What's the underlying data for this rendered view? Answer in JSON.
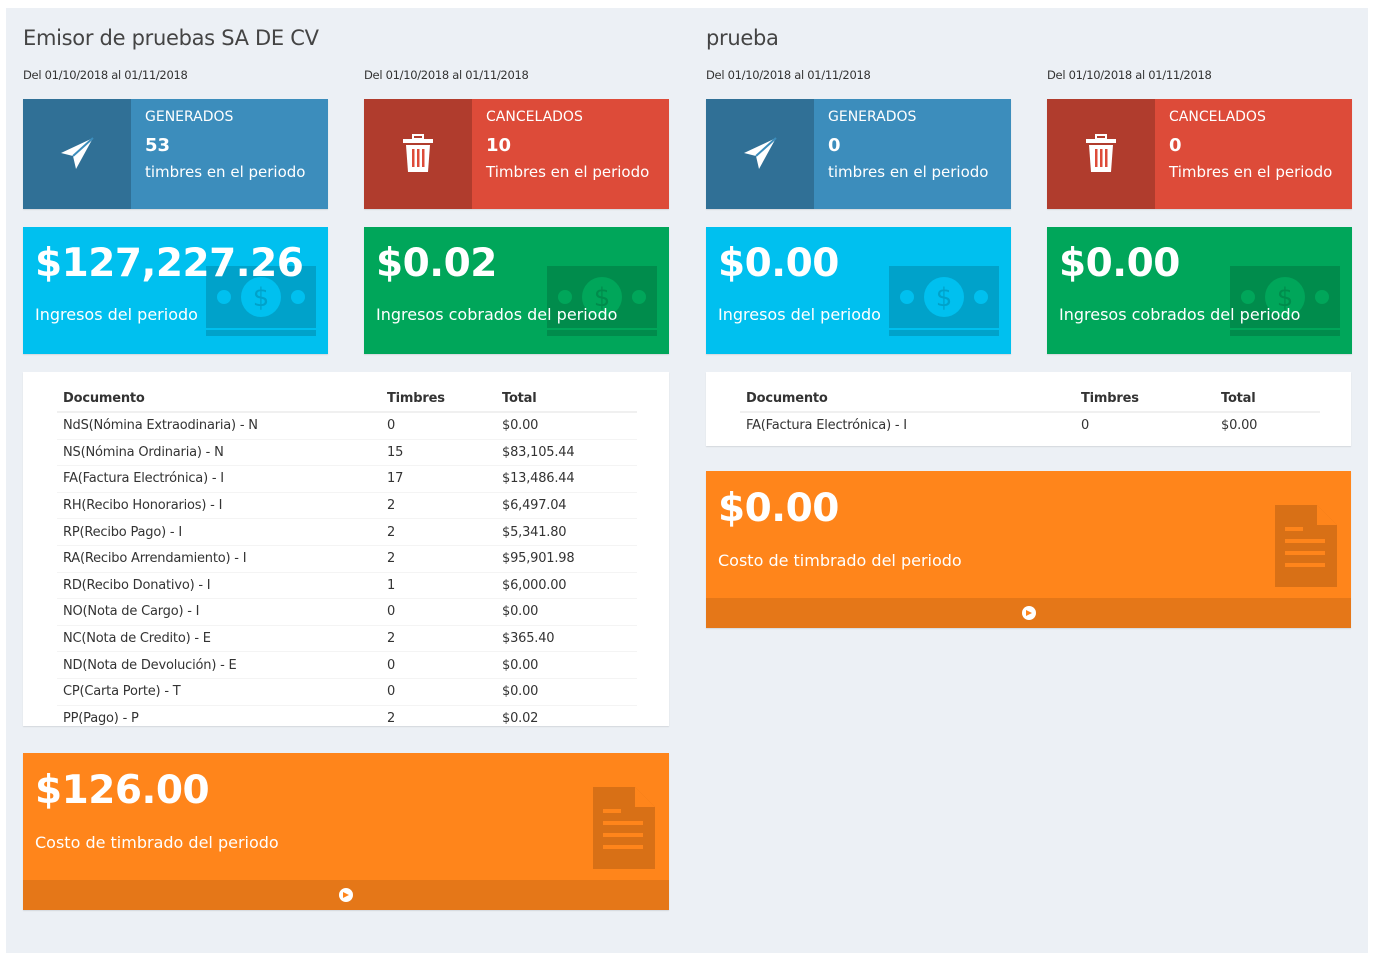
{
  "columns": [
    {
      "title": "Emisor de pruebas SA DE CV",
      "period_a": "Del 01/10/2018 al 01/11/2018",
      "period_b": "Del 01/10/2018 al 01/11/2018",
      "generados": {
        "label": "GENERADOS",
        "number": "53",
        "desc": "timbres en el periodo",
        "icon": "paper-plane-icon"
      },
      "cancelados": {
        "label": "CANCELADOS",
        "number": "10",
        "desc": "Timbres en el periodo",
        "icon": "trash-icon"
      },
      "ingresos": {
        "value": "$127,227.26",
        "desc": "Ingresos del periodo",
        "icon": "money-icon"
      },
      "cobrados": {
        "value": "$0.02",
        "desc": "Ingresos cobrados del periodo",
        "icon": "money-icon"
      },
      "table": {
        "headers": [
          "Documento",
          "Timbres",
          "Total"
        ],
        "rows": [
          [
            "NdS(Nómina Extraodinaria) - N",
            "0",
            "$0.00"
          ],
          [
            "NS(Nómina Ordinaria) - N",
            "15",
            "$83,105.44"
          ],
          [
            "FA(Factura Electrónica) - I",
            "17",
            "$13,486.44"
          ],
          [
            "RH(Recibo Honorarios) - I",
            "2",
            "$6,497.04"
          ],
          [
            "RP(Recibo Pago) - I",
            "2",
            "$5,341.80"
          ],
          [
            "RA(Recibo Arrendamiento) - I",
            "2",
            "$95,901.98"
          ],
          [
            "RD(Recibo Donativo) - I",
            "1",
            "$6,000.00"
          ],
          [
            "NO(Nota de Cargo) - I",
            "0",
            "$0.00"
          ],
          [
            "NC(Nota de Credito) - E",
            "2",
            "$365.40"
          ],
          [
            "ND(Nota de Devolución) - E",
            "0",
            "$0.00"
          ],
          [
            "CP(Carta Porte) - T",
            "0",
            "$0.00"
          ],
          [
            "PP(Pago) - P",
            "2",
            "$0.02"
          ]
        ]
      },
      "costo": {
        "value": "$126.00",
        "desc": "Costo de timbrado del periodo",
        "icon": "document-icon",
        "footer_icon": "arrow-circle-right-icon"
      }
    },
    {
      "title": "prueba",
      "period_a": "Del 01/10/2018 al 01/11/2018",
      "period_b": "Del 01/10/2018 al 01/11/2018",
      "generados": {
        "label": "GENERADOS",
        "number": "0",
        "desc": "timbres en el periodo",
        "icon": "paper-plane-icon"
      },
      "cancelados": {
        "label": "CANCELADOS",
        "number": "0",
        "desc": "Timbres en el periodo",
        "icon": "trash-icon"
      },
      "ingresos": {
        "value": "$0.00",
        "desc": "Ingresos del periodo",
        "icon": "money-icon"
      },
      "cobrados": {
        "value": "$0.00",
        "desc": "Ingresos cobrados del periodo",
        "icon": "money-icon"
      },
      "table": {
        "headers": [
          "Documento",
          "Timbres",
          "Total"
        ],
        "rows": [
          [
            "FA(Factura Electrónica) - I",
            "0",
            "$0.00"
          ]
        ]
      },
      "costo": {
        "value": "$0.00",
        "desc": "Costo de timbrado del periodo",
        "icon": "document-icon",
        "footer_icon": "arrow-circle-right-icon"
      }
    }
  ],
  "colors": {
    "blue": "#3c8dbc",
    "red": "#dd4b39",
    "aqua": "#00c0ef",
    "green": "#00a65a",
    "orange": "#ff851b",
    "background": "#ecf0f5"
  }
}
